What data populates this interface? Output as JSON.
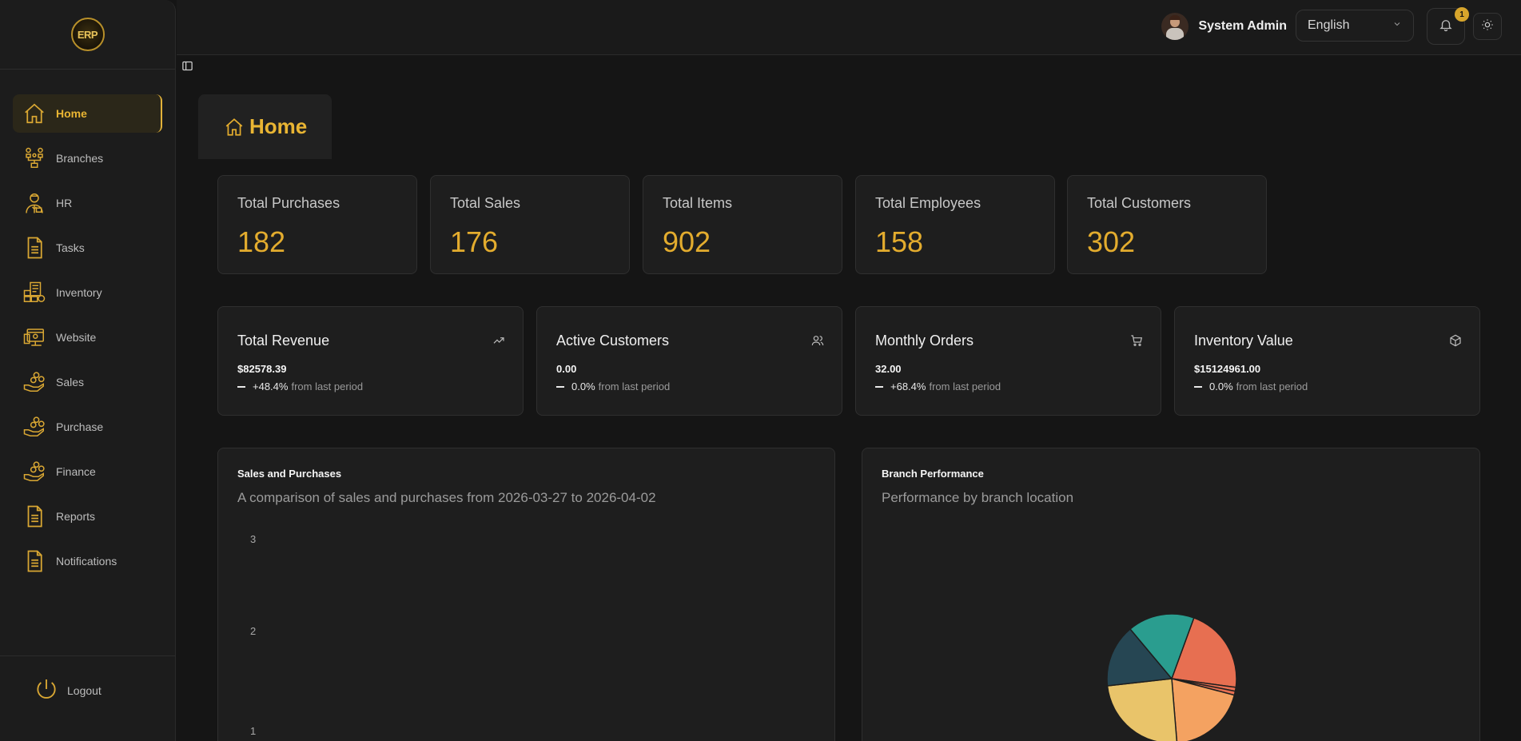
{
  "logo": {
    "text": "ERP"
  },
  "sidebar": {
    "items": [
      {
        "label": "Home",
        "icon": "home-icon"
      },
      {
        "label": "Branches",
        "icon": "branches-icon"
      },
      {
        "label": "HR",
        "icon": "hr-icon"
      },
      {
        "label": "Tasks",
        "icon": "document-icon"
      },
      {
        "label": "Inventory",
        "icon": "inventory-icon"
      },
      {
        "label": "Website",
        "icon": "website-icon"
      },
      {
        "label": "Sales",
        "icon": "hand-coins-icon"
      },
      {
        "label": "Purchase",
        "icon": "hand-coins-icon"
      },
      {
        "label": "Finance",
        "icon": "hand-coins-icon"
      },
      {
        "label": "Reports",
        "icon": "document-icon"
      },
      {
        "label": "Notifications",
        "icon": "document-icon"
      }
    ],
    "logout": "Logout"
  },
  "topbar": {
    "user_name": "System Admin",
    "language": "English",
    "notification_count": "1"
  },
  "page": {
    "title": "Home"
  },
  "stats": [
    {
      "label": "Total Purchases",
      "value": "182"
    },
    {
      "label": "Total Sales",
      "value": "176"
    },
    {
      "label": "Total Items",
      "value": "902"
    },
    {
      "label": "Total Employees",
      "value": "158"
    },
    {
      "label": "Total Customers",
      "value": "302"
    }
  ],
  "kpis": [
    {
      "label": "Total Revenue",
      "value": "$82578.39",
      "change": "+48.4%",
      "suffix": "from last period",
      "icon": "trending-up-icon"
    },
    {
      "label": "Active Customers",
      "value": "0.00",
      "change": "0.0%",
      "suffix": "from last period",
      "icon": "users-icon"
    },
    {
      "label": "Monthly Orders",
      "value": "32.00",
      "change": "+68.4%",
      "suffix": "from last period",
      "icon": "cart-icon"
    },
    {
      "label": "Inventory Value",
      "value": "$15124961.00",
      "change": "0.0%",
      "suffix": "from last period",
      "icon": "box-icon"
    }
  ],
  "sales_chart": {
    "title": "Sales and Purchases",
    "subtitle": "A comparison of sales and purchases from 2026-03-27 to 2026-04-02",
    "y_ticks": [
      "3",
      "2",
      "1"
    ]
  },
  "branch_chart": {
    "title": "Branch Performance",
    "subtitle": "Performance by branch location"
  },
  "chart_data": [
    {
      "type": "line",
      "title": "Sales and Purchases",
      "y_ticks": [
        1,
        2,
        3
      ],
      "series": []
    },
    {
      "type": "pie",
      "title": "Branch Performance",
      "slices": [
        {
          "value": 22,
          "color": "#e76f51"
        },
        {
          "value": 1,
          "color": "#e76f51"
        },
        {
          "value": 1,
          "color": "#e76f51"
        },
        {
          "value": 20,
          "color": "#f4a261"
        },
        {
          "value": 25,
          "color": "#e9c46a"
        },
        {
          "value": 16,
          "color": "#264653"
        },
        {
          "value": 17,
          "color": "#2a9d8f"
        }
      ]
    }
  ],
  "colors": {
    "accent": "#e3ac2e",
    "background": "#151515",
    "card": "#1e1e1e"
  }
}
